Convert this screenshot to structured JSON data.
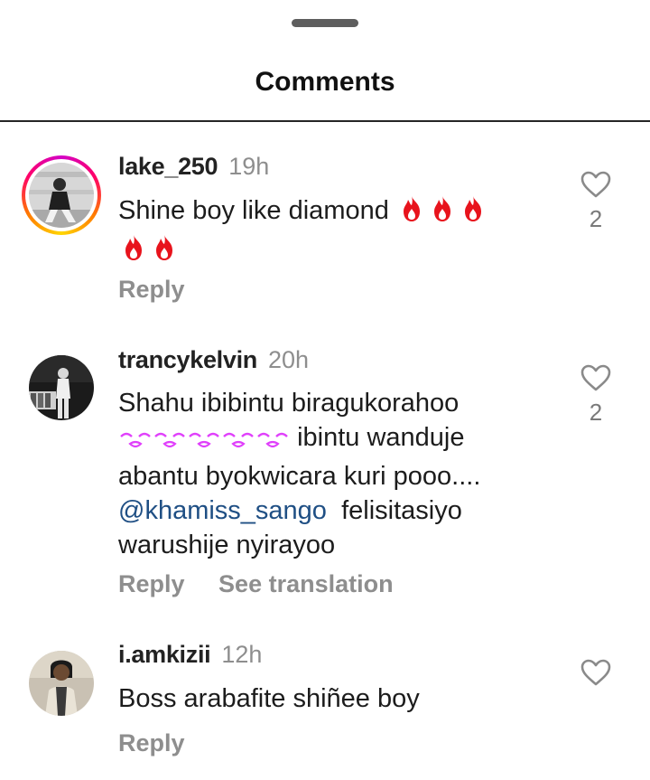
{
  "sheet": {
    "title": "Comments"
  },
  "colors": {
    "mention": "#1f4f84",
    "muted": "#8e8e8e",
    "fire": "#e8131c",
    "kiss": "#e040fb"
  },
  "comments": [
    {
      "username": "lake_250",
      "time": "19h",
      "text": "Shine boy like diamond",
      "emojis": [
        "fire",
        "fire",
        "fire",
        "fire",
        "fire"
      ],
      "likes": "2",
      "reply_label": "Reply",
      "has_story_ring": true
    },
    {
      "username": "trancykelvin",
      "time": "20h",
      "text_line1": "Shahu ibibintu biragukorahoo",
      "emojis": [
        "kiss",
        "kiss",
        "kiss",
        "kiss",
        "kiss"
      ],
      "text_line2": " ibintu wanduje",
      "text_line3": "abantu byokwicara kuri pooo....",
      "mention": "@khamiss_sango",
      "text_line4": "  felisitasiyo",
      "text_line5": "warushije nyirayoo",
      "likes": "2",
      "reply_label": "Reply",
      "translate_label": "See translation"
    },
    {
      "username": "i.amkizii",
      "time": "12h",
      "text": "Boss arabafite shiñee boy",
      "reply_label": "Reply"
    }
  ]
}
